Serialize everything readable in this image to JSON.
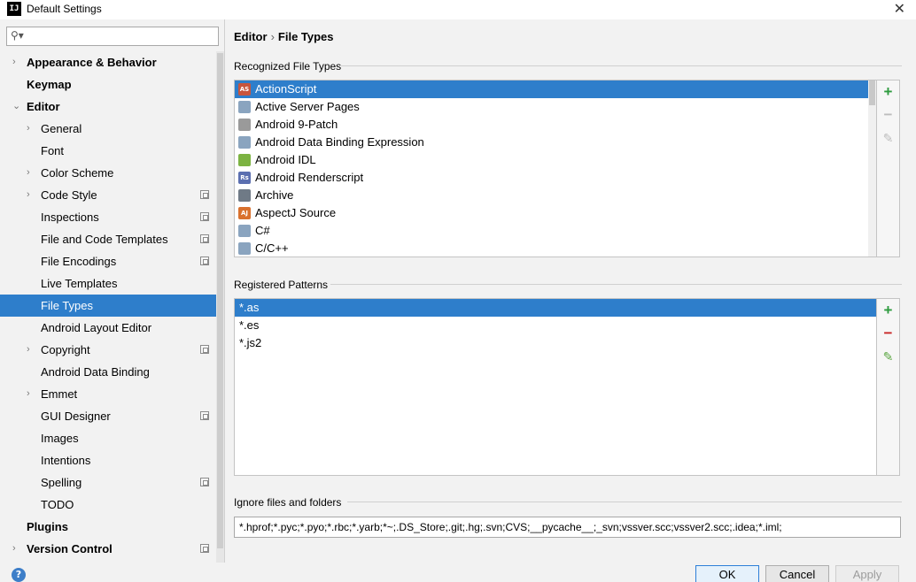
{
  "window": {
    "title": "Default Settings",
    "close_glyph": "✕"
  },
  "search": {
    "placeholder": "",
    "icon": "search-icon"
  },
  "tree": [
    {
      "label": "Appearance & Behavior",
      "bold": true,
      "arrow": "›",
      "indent": 0
    },
    {
      "label": "Keymap",
      "bold": true,
      "arrow": "",
      "indent": 0
    },
    {
      "label": "Editor",
      "bold": true,
      "arrow": "⌄",
      "indent": 0
    },
    {
      "label": "General",
      "arrow": "›",
      "indent": 1
    },
    {
      "label": "Font",
      "arrow": "",
      "indent": 1
    },
    {
      "label": "Color Scheme",
      "arrow": "›",
      "indent": 1
    },
    {
      "label": "Code Style",
      "arrow": "›",
      "indent": 1,
      "project": true
    },
    {
      "label": "Inspections",
      "arrow": "",
      "indent": 1,
      "project": true
    },
    {
      "label": "File and Code Templates",
      "arrow": "",
      "indent": 1,
      "project": true
    },
    {
      "label": "File Encodings",
      "arrow": "",
      "indent": 1,
      "project": true
    },
    {
      "label": "Live Templates",
      "arrow": "",
      "indent": 1
    },
    {
      "label": "File Types",
      "arrow": "",
      "indent": 1,
      "selected": true
    },
    {
      "label": "Android Layout Editor",
      "arrow": "",
      "indent": 1
    },
    {
      "label": "Copyright",
      "arrow": "›",
      "indent": 1,
      "project": true
    },
    {
      "label": "Android Data Binding",
      "arrow": "",
      "indent": 1
    },
    {
      "label": "Emmet",
      "arrow": "›",
      "indent": 1
    },
    {
      "label": "GUI Designer",
      "arrow": "",
      "indent": 1,
      "project": true
    },
    {
      "label": "Images",
      "arrow": "",
      "indent": 1
    },
    {
      "label": "Intentions",
      "arrow": "",
      "indent": 1
    },
    {
      "label": "Spelling",
      "arrow": "",
      "indent": 1,
      "project": true
    },
    {
      "label": "TODO",
      "arrow": "",
      "indent": 1
    },
    {
      "label": "Plugins",
      "bold": true,
      "arrow": "",
      "indent": 0
    },
    {
      "label": "Version Control",
      "bold": true,
      "arrow": "›",
      "indent": 0,
      "project": true
    }
  ],
  "breadcrumb": {
    "parent": "Editor",
    "separator": "›",
    "current": "File Types"
  },
  "recognized": {
    "title": "Recognized File Types",
    "items": [
      {
        "label": "ActionScript",
        "icon": "actionscript-icon",
        "badge": "AS",
        "color": "#c8553d",
        "selected": true
      },
      {
        "label": "Active Server Pages",
        "icon": "file-icon",
        "badge": "",
        "color": "#8aa4bf"
      },
      {
        "label": "Android 9-Patch",
        "icon": "folder-icon",
        "badge": "",
        "color": "#9a9a9a"
      },
      {
        "label": "Android Data Binding Expression",
        "icon": "file-icon",
        "badge": "",
        "color": "#8aa4bf"
      },
      {
        "label": "Android IDL",
        "icon": "android-icon",
        "badge": "",
        "color": "#7cb342"
      },
      {
        "label": "Android Renderscript",
        "icon": "renderscript-icon",
        "badge": "Rs",
        "color": "#5b6fb0"
      },
      {
        "label": "Archive",
        "icon": "archive-icon",
        "badge": "",
        "color": "#6f7a86"
      },
      {
        "label": "AspectJ Source",
        "icon": "aspectj-icon",
        "badge": "AJ",
        "color": "#d9712e"
      },
      {
        "label": "C#",
        "icon": "file-icon",
        "badge": "",
        "color": "#8aa4bf"
      },
      {
        "label": "C/C++",
        "icon": "file-icon",
        "badge": "",
        "color": "#8aa4bf"
      }
    ]
  },
  "patterns": {
    "title": "Registered Patterns",
    "items": [
      {
        "label": "*.as",
        "selected": true
      },
      {
        "label": "*.es"
      },
      {
        "label": "*.js2"
      }
    ]
  },
  "ignore": {
    "title": "Ignore files and folders",
    "value": "*.hprof;*.pyc;*.pyo;*.rbc;*.yarb;*~;.DS_Store;.git;.hg;.svn;CVS;__pycache__;_svn;vssver.scc;vssver2.scc;.idea;*.iml;"
  },
  "toolbar": {
    "add": "+",
    "remove": "−",
    "edit": "✎"
  },
  "buttons": {
    "help": "?",
    "ok": "OK",
    "cancel": "Cancel",
    "apply": "Apply"
  }
}
